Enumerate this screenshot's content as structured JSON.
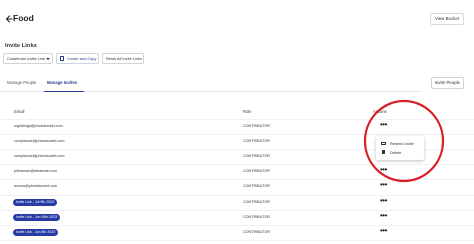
{
  "header": {
    "title": "Food",
    "view_bucket_label": "View Bucket"
  },
  "invite_links": {
    "title": "Invite Links",
    "select_value": "Contributor Invite Link",
    "create_copy_label": "Create and Copy",
    "reset_label": "Reset All Invite Links"
  },
  "tabs": {
    "manage_people": "Manage People",
    "manage_invites": "Manage Invites",
    "invite_people": "Invite People"
  },
  "table": {
    "headers": {
      "email": "Email",
      "role": "Role",
      "actions": "Actions"
    },
    "rows": [
      {
        "email": "mgiddings@photobucket.com",
        "role": "CONTRIBUTOR"
      },
      {
        "email": "compliance@photobucket.com",
        "role": "CONTRIBUTOR"
      },
      {
        "email": "compliance@photobucket.com",
        "role": "CONTRIBUTOR"
      },
      {
        "email": "pillowman@fahalmail.com",
        "role": "CONTRIBUTOR"
      },
      {
        "email": "accrna@photobucket.com",
        "role": "CONTRIBUTOR"
      },
      {
        "link": "Invite Link - Jul 9th 2023",
        "role": "CONTRIBUTOR"
      },
      {
        "link": "Invite Link - Jun 16th 2023",
        "role": "CONTRIBUTOR"
      },
      {
        "link": "Invite Link - Jun 5th 2023",
        "role": "CONTRIBUTOR"
      },
      {
        "link": "Invite Link - Jul 4th 2023",
        "role": "CONTRIBUTOR"
      }
    ],
    "actions_glyph": "•••"
  },
  "action_menu": {
    "resend": "Resend Invite",
    "delete": "Delete"
  },
  "colors": {
    "accent": "#263ba3",
    "annotation": "#d81f26"
  },
  "icons": [
    "back-arrow-icon",
    "caret-down-icon",
    "copy-icon",
    "more-actions-icon",
    "mail-icon",
    "trash-icon"
  ]
}
